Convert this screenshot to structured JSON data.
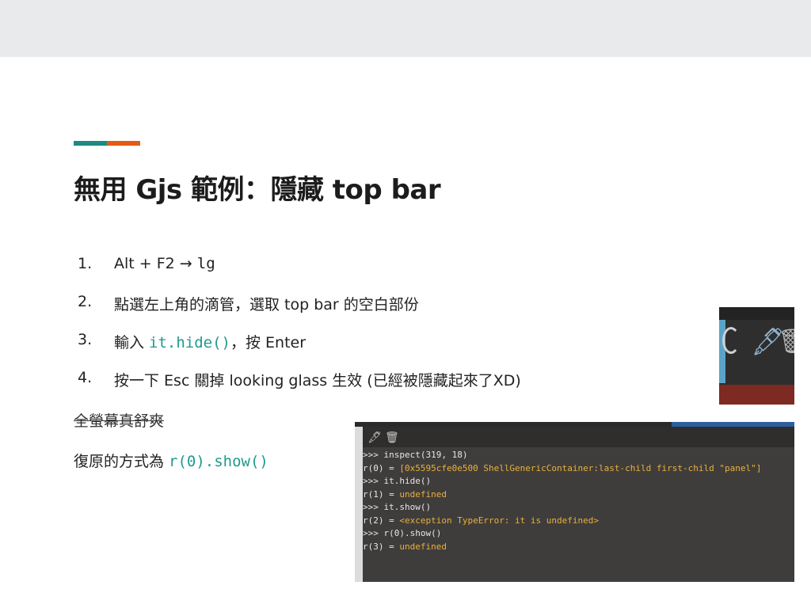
{
  "colors": {
    "accent_teal": "#1e8a82",
    "accent_orange": "#e45b14",
    "code_teal": "#1e9a8f"
  },
  "title": "無用 Gjs 範例：隱藏 top bar",
  "steps": [
    {
      "num": "1.",
      "prefix": "Alt + F2 → ",
      "code": "lg",
      "suffix": ""
    },
    {
      "num": "2.",
      "prefix": "點選左上角的滴管，選取 top bar 的空白部份",
      "code": "",
      "suffix": ""
    },
    {
      "num": "3.",
      "prefix": "輸入 ",
      "code": "it.hide()",
      "suffix": "，按 Enter"
    },
    {
      "num": "4.",
      "prefix": "按一下 Esc 關掉 looking glass 生效 (已經被隱藏起來了XD)",
      "code": "",
      "suffix": ""
    }
  ],
  "strike_text": "全螢幕真舒爽",
  "restore": {
    "prefix": "復原的方式為 ",
    "code": "r(0).show()"
  },
  "lg_small": {
    "icons": [
      "inspect-circle-icon",
      "eyedropper-icon",
      "trash-icon"
    ]
  },
  "terminal": {
    "icons": [
      "eyedropper-icon",
      "trash-icon"
    ],
    "lines": [
      {
        "text": ">>> inspect(319, 18)",
        "value": ""
      },
      {
        "text": "r(0) = ",
        "value": "[0x5595cfe0e500 ShellGenericContainer:last-child first-child \"panel\"]"
      },
      {
        "text": ">>> it.hide()",
        "value": ""
      },
      {
        "text": "r(1) = ",
        "value": "undefined"
      },
      {
        "text": ">>> it.show()",
        "value": ""
      },
      {
        "text": "r(2) = ",
        "value": "<exception TypeError: it is undefined>"
      },
      {
        "text": ">>> r(0).show()",
        "value": ""
      },
      {
        "text": "r(3) = ",
        "value": "undefined"
      }
    ]
  }
}
